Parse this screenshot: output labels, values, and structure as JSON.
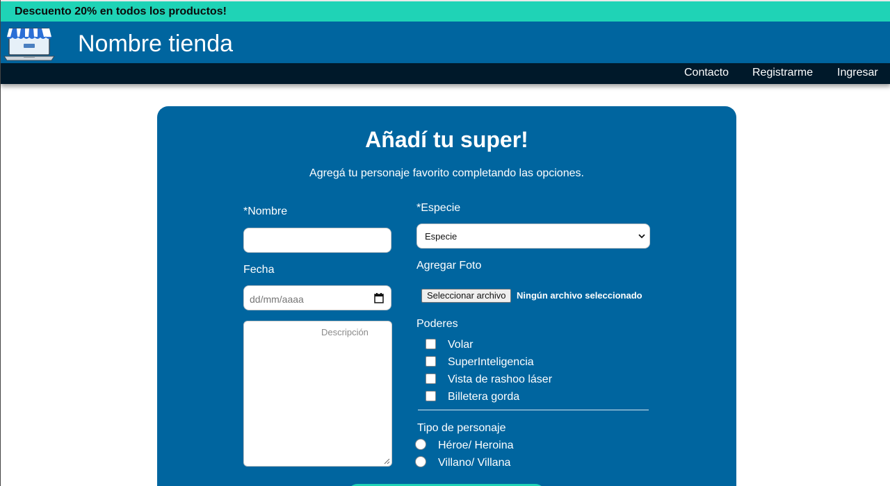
{
  "promo": {
    "text": "Descuento 20% en todos los productos!"
  },
  "header": {
    "store_name": "Nombre tienda"
  },
  "nav": {
    "items": [
      "Contacto",
      "Registrarme",
      "Ingresar"
    ]
  },
  "form": {
    "title": "Añadí tu super!",
    "subtitle": "Agregá tu personaje favorito completando las opciones.",
    "nombre_label": "*Nombre",
    "nombre_value": "",
    "fecha_label": "Fecha",
    "fecha_placeholder": "dd/mm/aaaa",
    "descripcion_placeholder": "Descripción",
    "especie_label": "*Especie",
    "especie_selected": "Especie",
    "foto_label": "Agregar Foto",
    "file_button": "Seleccionar archivo",
    "file_status": "Ningún archivo seleccionado",
    "poderes_label": "Poderes",
    "poderes": [
      "Volar",
      "SuperInteligencia",
      "Vista de rashoo láser",
      "Billetera gorda"
    ],
    "tipo_label": "Tipo de personaje",
    "tipos": [
      "Héroe/ Heroina",
      "Villano/ Villana"
    ]
  },
  "colors": {
    "promo_bg": "#1fd3b6",
    "header_bg": "#00659f",
    "nav_bg": "#00192a",
    "card_bg": "#00659f",
    "text": "#ffffff"
  }
}
